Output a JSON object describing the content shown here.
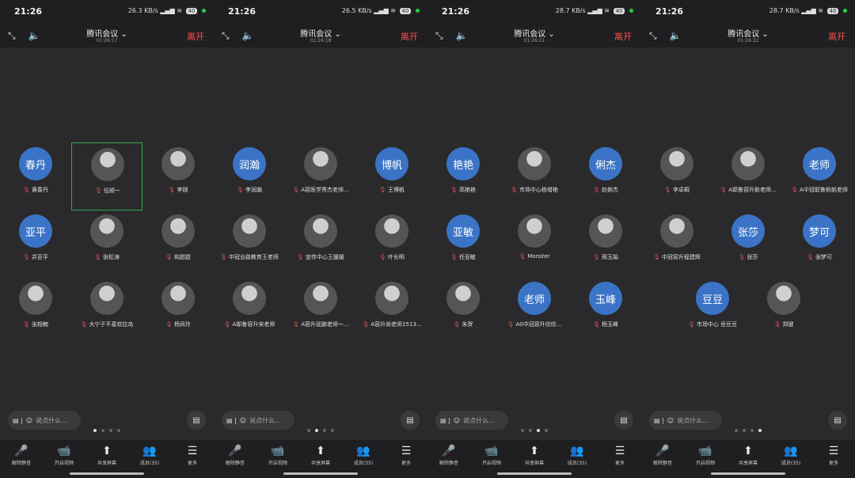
{
  "screens": [
    {
      "time": "21:26",
      "network": "26.3 KB/s",
      "battery": "40",
      "title": "腾讯会议",
      "elapsed": "01:26:17",
      "leave": "离开",
      "participants": [
        {
          "initials": "春丹",
          "name": "黄春丹",
          "photo": false,
          "speaking": false
        },
        {
          "initials": "",
          "name": "伍顺一",
          "photo": true,
          "speaking": true
        },
        {
          "initials": "",
          "name": "李刚",
          "photo": true,
          "speaking": false
        },
        {
          "initials": "亚平",
          "name": "井亚平",
          "photo": false,
          "speaking": false
        },
        {
          "initials": "",
          "name": "张松涛",
          "photo": true,
          "speaking": false
        },
        {
          "initials": "",
          "name": "和甜甜",
          "photo": true,
          "speaking": false
        },
        {
          "initials": "",
          "name": "张相楠",
          "photo": true,
          "speaking": false
        },
        {
          "initials": "",
          "name": "大宁子不喜欢拉岛",
          "photo": true,
          "speaking": false
        },
        {
          "initials": "",
          "name": "杨凤玲",
          "photo": true,
          "speaking": false
        }
      ],
      "chat_placeholder": "说点什么...",
      "page": 0
    },
    {
      "time": "21:26",
      "network": "26.5 KB/s",
      "battery": "40",
      "title": "腾讯会议",
      "elapsed": "01:26:18",
      "leave": "离开",
      "participants": [
        {
          "initials": "润瀚",
          "name": "李润瀚",
          "photo": false,
          "speaking": false
        },
        {
          "initials": "",
          "name": "A容医学秀杰老师...",
          "photo": true,
          "speaking": false
        },
        {
          "initials": "博帆",
          "name": "王博帆",
          "photo": false,
          "speaking": false
        },
        {
          "initials": "",
          "name": "中冠业路教育王老师",
          "photo": true,
          "speaking": false
        },
        {
          "initials": "",
          "name": "宣传中心王媛媛",
          "photo": true,
          "speaking": false
        },
        {
          "initials": "",
          "name": "叶长明",
          "photo": true,
          "speaking": false
        },
        {
          "initials": "",
          "name": "A耶鲁容升宋老师",
          "photo": true,
          "speaking": false
        },
        {
          "initials": "",
          "name": "A容升延鹏老师～...",
          "photo": true,
          "speaking": false
        },
        {
          "initials": "",
          "name": "A容升尚老师1513...",
          "photo": true,
          "speaking": false
        }
      ],
      "chat_placeholder": "说点什么...",
      "page": 1
    },
    {
      "time": "21:26",
      "network": "28.7 KB/s",
      "battery": "40",
      "title": "腾讯会议",
      "elapsed": "01:26:21",
      "leave": "离开",
      "participants": [
        {
          "initials": "艳艳",
          "name": "高艳艳",
          "photo": false,
          "speaking": false
        },
        {
          "initials": "",
          "name": "市场中心杨增艳",
          "photo": true,
          "speaking": false
        },
        {
          "initials": "俐杰",
          "name": "赵俐杰",
          "photo": false,
          "speaking": false
        },
        {
          "initials": "亚敏",
          "name": "任亚敏",
          "photo": false,
          "speaking": false
        },
        {
          "initials": "",
          "name": "Monster",
          "photo": true,
          "speaking": false
        },
        {
          "initials": "",
          "name": "邢玉娟",
          "photo": true,
          "speaking": false
        },
        {
          "initials": "",
          "name": "朱贺",
          "photo": true,
          "speaking": false
        },
        {
          "initials": "老师",
          "name": "A0中冠容升欣欣...",
          "photo": false,
          "speaking": false
        },
        {
          "initials": "玉峰",
          "name": "杨玉峰",
          "photo": false,
          "speaking": false
        }
      ],
      "chat_placeholder": "说点什么...",
      "page": 2
    },
    {
      "time": "21:26",
      "network": "28.7 KB/s",
      "battery": "40",
      "title": "腾讯会议",
      "elapsed": "01:26:22",
      "leave": "离开",
      "participants": [
        {
          "initials": "",
          "name": "李卓桐",
          "photo": true,
          "speaking": false
        },
        {
          "initials": "",
          "name": "A耶鲁容升耿老师...",
          "photo": true,
          "speaking": false
        },
        {
          "initials": "老师",
          "name": "A中冠耶鲁帆帆老师",
          "photo": false,
          "speaking": false
        },
        {
          "initials": "",
          "name": "中冠容升程建辉",
          "photo": true,
          "speaking": false
        },
        {
          "initials": "张莎",
          "name": "张莎",
          "photo": false,
          "speaking": false
        },
        {
          "initials": "梦可",
          "name": "张梦可",
          "photo": false,
          "speaking": false
        },
        {
          "initials": "豆豆",
          "name": "市场中心 岳豆豆",
          "photo": false,
          "speaking": false
        },
        {
          "initials": "",
          "name": "郑键",
          "photo": true,
          "speaking": false
        }
      ],
      "chat_placeholder": "说点什么...",
      "page": 3
    }
  ],
  "bottom_buttons": [
    {
      "label": "解除静音",
      "icon": "mic-muted-icon",
      "glyph": "🎤",
      "red": true
    },
    {
      "label": "开启视频",
      "icon": "video-off-icon",
      "glyph": "📹",
      "red": false
    },
    {
      "label": "共享屏幕",
      "icon": "share-screen-icon",
      "glyph": "⬆",
      "red": false
    },
    {
      "label": "成员(35)",
      "icon": "members-icon",
      "glyph": "👥",
      "red": false
    },
    {
      "label": "更多",
      "icon": "more-icon",
      "glyph": "☰",
      "red": false
    }
  ],
  "colors": {
    "leave": "#ff4d4f",
    "avatar": "#3b74c6",
    "speaking_border": "#2fa84f"
  }
}
